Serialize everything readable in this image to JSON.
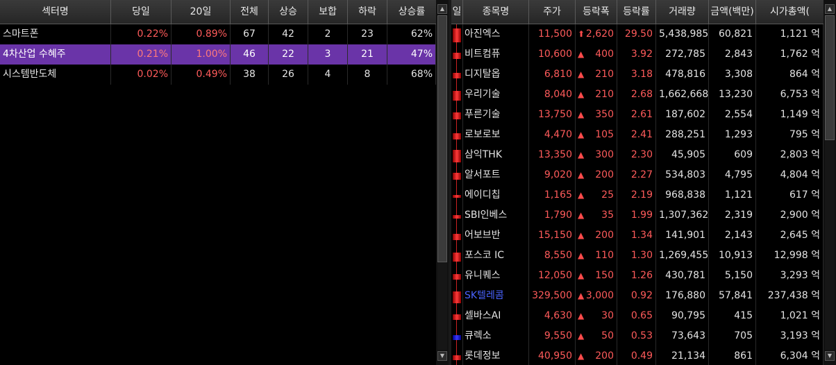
{
  "sector_table": {
    "headers": [
      "섹터명",
      "당일",
      "20일",
      "전체",
      "상승",
      "보합",
      "하락",
      "상승률"
    ],
    "rows": [
      {
        "name": "스마트폰",
        "today": "0.22%",
        "d20": "0.89%",
        "total": "67",
        "up": "42",
        "flat": "2",
        "down": "23",
        "up_rate": "62%"
      },
      {
        "name": "4차산업 수혜주",
        "today": "0.21%",
        "d20": "1.00%",
        "total": "46",
        "up": "22",
        "flat": "3",
        "down": "21",
        "up_rate": "47%"
      },
      {
        "name": "시스템반도체",
        "today": "0.02%",
        "d20": "0.49%",
        "total": "38",
        "up": "26",
        "flat": "4",
        "down": "8",
        "up_rate": "68%"
      }
    ],
    "selected_index": 1
  },
  "stock_table": {
    "headers": [
      "일",
      "종목명",
      "주가",
      "등락폭",
      "등락률",
      "거래량",
      "금액(백만)",
      "시가총액("
    ],
    "rows": [
      {
        "name": "아진엑스",
        "price": "11,500",
        "arrow": "⬆",
        "change": "2,620",
        "rate": "29.50",
        "volume": "5,438,985",
        "amount": "60,821",
        "mcap": "1,121 억",
        "bar_frac": 0.75,
        "bar_color": "red",
        "name_color": "default"
      },
      {
        "name": "비트컴퓨",
        "price": "10,600",
        "arrow": "▲",
        "change": "400",
        "rate": "3.92",
        "volume": "272,785",
        "amount": "2,843",
        "mcap": "1,762 억",
        "bar_frac": 0.35,
        "bar_color": "red",
        "name_color": "default"
      },
      {
        "name": "디지탈옵",
        "price": "6,810",
        "arrow": "▲",
        "change": "210",
        "rate": "3.18",
        "volume": "478,816",
        "amount": "3,308",
        "mcap": "864 억",
        "bar_frac": 0.3,
        "bar_color": "red",
        "name_color": "default"
      },
      {
        "name": "우리기술",
        "price": "8,040",
        "arrow": "▲",
        "change": "210",
        "rate": "2.68",
        "volume": "1,662,668",
        "amount": "13,230",
        "mcap": "6,753 억",
        "bar_frac": 0.55,
        "bar_color": "red",
        "name_color": "default"
      },
      {
        "name": "푸른기술",
        "price": "13,750",
        "arrow": "▲",
        "change": "350",
        "rate": "2.61",
        "volume": "187,602",
        "amount": "2,554",
        "mcap": "1,149 억",
        "bar_frac": 0.4,
        "bar_color": "red",
        "name_color": "default"
      },
      {
        "name": "로보로보",
        "price": "4,470",
        "arrow": "▲",
        "change": "105",
        "rate": "2.41",
        "volume": "288,251",
        "amount": "1,293",
        "mcap": "795 억",
        "bar_frac": 0.35,
        "bar_color": "red",
        "name_color": "default"
      },
      {
        "name": "삼익THK",
        "price": "13,350",
        "arrow": "▲",
        "change": "300",
        "rate": "2.30",
        "volume": "45,905",
        "amount": "609",
        "mcap": "2,803 억",
        "bar_frac": 0.7,
        "bar_color": "red",
        "name_color": "default"
      },
      {
        "name": "알서포트",
        "price": "9,020",
        "arrow": "▲",
        "change": "200",
        "rate": "2.27",
        "volume": "534,803",
        "amount": "4,795",
        "mcap": "4,804 억",
        "bar_frac": 0.4,
        "bar_color": "red",
        "name_color": "default"
      },
      {
        "name": "에이디칩",
        "price": "1,165",
        "arrow": "▲",
        "change": "25",
        "rate": "2.19",
        "volume": "968,838",
        "amount": "1,121",
        "mcap": "617 억",
        "bar_frac": 0.15,
        "bar_color": "red",
        "name_color": "default"
      },
      {
        "name": "SBI인베스",
        "price": "1,790",
        "arrow": "▲",
        "change": "35",
        "rate": "1.99",
        "volume": "1,307,362",
        "amount": "2,319",
        "mcap": "2,900 억",
        "bar_frac": 0.2,
        "bar_color": "red",
        "name_color": "default"
      },
      {
        "name": "어보브반",
        "price": "15,150",
        "arrow": "▲",
        "change": "200",
        "rate": "1.34",
        "volume": "141,901",
        "amount": "2,143",
        "mcap": "2,645 억",
        "bar_frac": 0.35,
        "bar_color": "red",
        "name_color": "default"
      },
      {
        "name": "포스코 IC",
        "price": "8,550",
        "arrow": "▲",
        "change": "110",
        "rate": "1.30",
        "volume": "1,269,455",
        "amount": "10,913",
        "mcap": "12,998 억",
        "bar_frac": 0.5,
        "bar_color": "red",
        "name_color": "default"
      },
      {
        "name": "유니퀘스",
        "price": "12,050",
        "arrow": "▲",
        "change": "150",
        "rate": "1.26",
        "volume": "430,781",
        "amount": "5,150",
        "mcap": "3,293 억",
        "bar_frac": 0.3,
        "bar_color": "red",
        "name_color": "default"
      },
      {
        "name": "SK텔레콤",
        "price": "329,500",
        "arrow": "▲",
        "change": "3,000",
        "rate": "0.92",
        "volume": "176,880",
        "amount": "57,841",
        "mcap": "237,438 억",
        "bar_frac": 0.65,
        "bar_color": "red",
        "name_color": "blue"
      },
      {
        "name": "셀바스AI",
        "price": "4,630",
        "arrow": "▲",
        "change": "30",
        "rate": "0.65",
        "volume": "90,795",
        "amount": "415",
        "mcap": "1,021 억",
        "bar_frac": 0.3,
        "bar_color": "red",
        "name_color": "default"
      },
      {
        "name": "큐렉소",
        "price": "9,550",
        "arrow": "▲",
        "change": "50",
        "rate": "0.53",
        "volume": "73,643",
        "amount": "705",
        "mcap": "3,193 억",
        "bar_frac": 0.25,
        "bar_color": "blue",
        "name_color": "default"
      },
      {
        "name": "롯데정보",
        "price": "40,950",
        "arrow": "▲",
        "change": "200",
        "rate": "0.49",
        "volume": "21,134",
        "amount": "861",
        "mcap": "6,304 억",
        "bar_frac": 0.25,
        "bar_color": "red",
        "name_color": "default"
      }
    ]
  }
}
